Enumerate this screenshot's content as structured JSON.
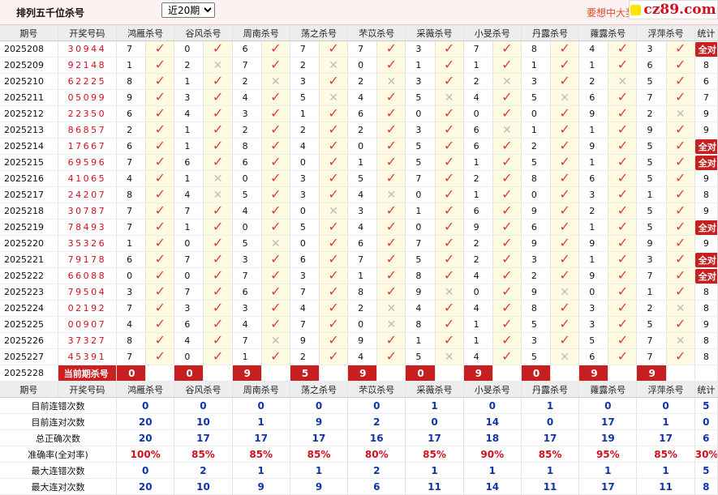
{
  "header": {
    "title": "排列五千位杀号",
    "select_value": "近20期",
    "promo": "要想中大奖",
    "logo_text": "cz89.com"
  },
  "columns": {
    "period": "期号",
    "prize": "开奖号码",
    "experts": [
      "鸿雁杀号",
      "谷风杀号",
      "周南杀号",
      "荡之杀号",
      "芣苡杀号",
      "采薇杀号",
      "小旻杀号",
      "丹露杀号",
      "蕹露杀号",
      "浮萍杀号"
    ],
    "stat": "统计"
  },
  "rows": [
    {
      "period": "2025208",
      "prize": "30944",
      "k": [
        7,
        0,
        6,
        7,
        7,
        3,
        7,
        8,
        4,
        3
      ],
      "h": [
        1,
        1,
        1,
        1,
        1,
        1,
        1,
        1,
        1,
        1
      ],
      "stat": "全对"
    },
    {
      "period": "2025209",
      "prize": "92148",
      "k": [
        1,
        2,
        7,
        2,
        0,
        1,
        1,
        1,
        1,
        6
      ],
      "h": [
        1,
        0,
        1,
        0,
        1,
        1,
        1,
        1,
        1,
        1
      ],
      "stat": "8"
    },
    {
      "period": "2025210",
      "prize": "62225",
      "k": [
        8,
        1,
        2,
        3,
        2,
        3,
        2,
        3,
        2,
        5
      ],
      "h": [
        1,
        1,
        0,
        1,
        0,
        1,
        0,
        1,
        0,
        1
      ],
      "stat": "6"
    },
    {
      "period": "2025211",
      "prize": "05099",
      "k": [
        9,
        3,
        4,
        5,
        4,
        5,
        4,
        5,
        6,
        7
      ],
      "h": [
        1,
        1,
        1,
        0,
        1,
        0,
        1,
        0,
        1,
        1
      ],
      "stat": "7"
    },
    {
      "period": "2025212",
      "prize": "22350",
      "k": [
        6,
        4,
        3,
        1,
        6,
        0,
        0,
        0,
        9,
        2
      ],
      "h": [
        1,
        1,
        1,
        1,
        1,
        1,
        1,
        1,
        1,
        0
      ],
      "stat": "9"
    },
    {
      "period": "2025213",
      "prize": "86857",
      "k": [
        2,
        1,
        2,
        2,
        2,
        3,
        6,
        1,
        1,
        9
      ],
      "h": [
        1,
        1,
        1,
        1,
        1,
        1,
        0,
        1,
        1,
        1
      ],
      "stat": "9"
    },
    {
      "period": "2025214",
      "prize": "17667",
      "k": [
        6,
        1,
        8,
        4,
        0,
        5,
        6,
        2,
        9,
        5
      ],
      "h": [
        1,
        1,
        1,
        1,
        1,
        1,
        1,
        1,
        1,
        1
      ],
      "stat": "全对"
    },
    {
      "period": "2025215",
      "prize": "69596",
      "k": [
        7,
        6,
        6,
        0,
        1,
        5,
        1,
        5,
        1,
        5
      ],
      "h": [
        1,
        1,
        1,
        1,
        1,
        1,
        1,
        1,
        1,
        1
      ],
      "stat": "全对"
    },
    {
      "period": "2025216",
      "prize": "41065",
      "k": [
        4,
        1,
        0,
        3,
        5,
        7,
        2,
        8,
        6,
        5
      ],
      "h": [
        1,
        0,
        1,
        1,
        1,
        1,
        1,
        1,
        1,
        1
      ],
      "stat": "9"
    },
    {
      "period": "2025217",
      "prize": "24207",
      "k": [
        8,
        4,
        5,
        3,
        4,
        0,
        1,
        0,
        3,
        1
      ],
      "h": [
        1,
        0,
        1,
        1,
        0,
        1,
        1,
        1,
        1,
        1
      ],
      "stat": "8"
    },
    {
      "period": "2025218",
      "prize": "30787",
      "k": [
        7,
        7,
        4,
        0,
        3,
        1,
        6,
        9,
        2,
        5
      ],
      "h": [
        1,
        1,
        1,
        0,
        1,
        1,
        1,
        1,
        1,
        1
      ],
      "stat": "9"
    },
    {
      "period": "2025219",
      "prize": "78493",
      "k": [
        7,
        1,
        0,
        5,
        4,
        0,
        9,
        6,
        1,
        5
      ],
      "h": [
        1,
        1,
        1,
        1,
        1,
        1,
        1,
        1,
        1,
        1
      ],
      "stat": "全对"
    },
    {
      "period": "2025220",
      "prize": "35326",
      "k": [
        1,
        0,
        5,
        0,
        6,
        7,
        2,
        9,
        9,
        9
      ],
      "h": [
        1,
        1,
        0,
        1,
        1,
        1,
        1,
        1,
        1,
        1
      ],
      "stat": "9"
    },
    {
      "period": "2025221",
      "prize": "79178",
      "k": [
        6,
        7,
        3,
        6,
        7,
        5,
        2,
        3,
        1,
        3
      ],
      "h": [
        1,
        1,
        1,
        1,
        1,
        1,
        1,
        1,
        1,
        1
      ],
      "stat": "全对"
    },
    {
      "period": "2025222",
      "prize": "66088",
      "k": [
        0,
        0,
        7,
        3,
        1,
        8,
        4,
        2,
        9,
        7
      ],
      "h": [
        1,
        1,
        1,
        1,
        1,
        1,
        1,
        1,
        1,
        1
      ],
      "stat": "全对"
    },
    {
      "period": "2025223",
      "prize": "79504",
      "k": [
        3,
        7,
        6,
        7,
        8,
        9,
        0,
        9,
        0,
        1
      ],
      "h": [
        1,
        1,
        1,
        1,
        1,
        0,
        1,
        0,
        1,
        1
      ],
      "stat": "8"
    },
    {
      "period": "2025224",
      "prize": "02192",
      "k": [
        7,
        3,
        3,
        4,
        2,
        4,
        4,
        8,
        3,
        2
      ],
      "h": [
        1,
        1,
        1,
        1,
        0,
        1,
        1,
        1,
        1,
        0
      ],
      "stat": "8"
    },
    {
      "period": "2025225",
      "prize": "00907",
      "k": [
        4,
        6,
        4,
        7,
        0,
        8,
        1,
        5,
        3,
        5
      ],
      "h": [
        1,
        1,
        1,
        1,
        0,
        1,
        1,
        1,
        1,
        1
      ],
      "stat": "9"
    },
    {
      "period": "2025226",
      "prize": "37327",
      "k": [
        8,
        4,
        7,
        9,
        9,
        1,
        1,
        3,
        5,
        7
      ],
      "h": [
        1,
        1,
        0,
        1,
        1,
        1,
        1,
        1,
        1,
        0
      ],
      "stat": "8"
    },
    {
      "period": "2025227",
      "prize": "45391",
      "k": [
        7,
        0,
        1,
        2,
        4,
        5,
        4,
        5,
        6,
        7
      ],
      "h": [
        1,
        1,
        1,
        1,
        1,
        0,
        1,
        0,
        1,
        1
      ],
      "stat": "8"
    }
  ],
  "current": {
    "period": "2025228",
    "label": "当前期杀号",
    "k": [
      0,
      0,
      9,
      5,
      9,
      0,
      9,
      0,
      9,
      9
    ]
  },
  "stats": [
    {
      "label": "目前连错次数",
      "v": [
        "0",
        "0",
        "0",
        "0",
        "0",
        "1",
        "0",
        "1",
        "0",
        "0"
      ],
      "s": "5"
    },
    {
      "label": "目前连对次数",
      "v": [
        "20",
        "10",
        "1",
        "9",
        "2",
        "0",
        "14",
        "0",
        "17",
        "1"
      ],
      "s": "0"
    },
    {
      "label": "总正确次数",
      "v": [
        "20",
        "17",
        "17",
        "17",
        "16",
        "17",
        "18",
        "17",
        "19",
        "17"
      ],
      "s": "6"
    },
    {
      "label": "准确率(全对率)",
      "v": [
        "100%",
        "85%",
        "85%",
        "85%",
        "80%",
        "85%",
        "90%",
        "85%",
        "95%",
        "85%"
      ],
      "s": "30%",
      "red": true
    },
    {
      "label": "最大连错次数",
      "v": [
        "0",
        "2",
        "1",
        "1",
        "2",
        "1",
        "1",
        "1",
        "1",
        "1"
      ],
      "s": "5"
    },
    {
      "label": "最大连对次数",
      "v": [
        "20",
        "10",
        "9",
        "9",
        "6",
        "11",
        "14",
        "11",
        "17",
        "11"
      ],
      "s": "8"
    }
  ]
}
